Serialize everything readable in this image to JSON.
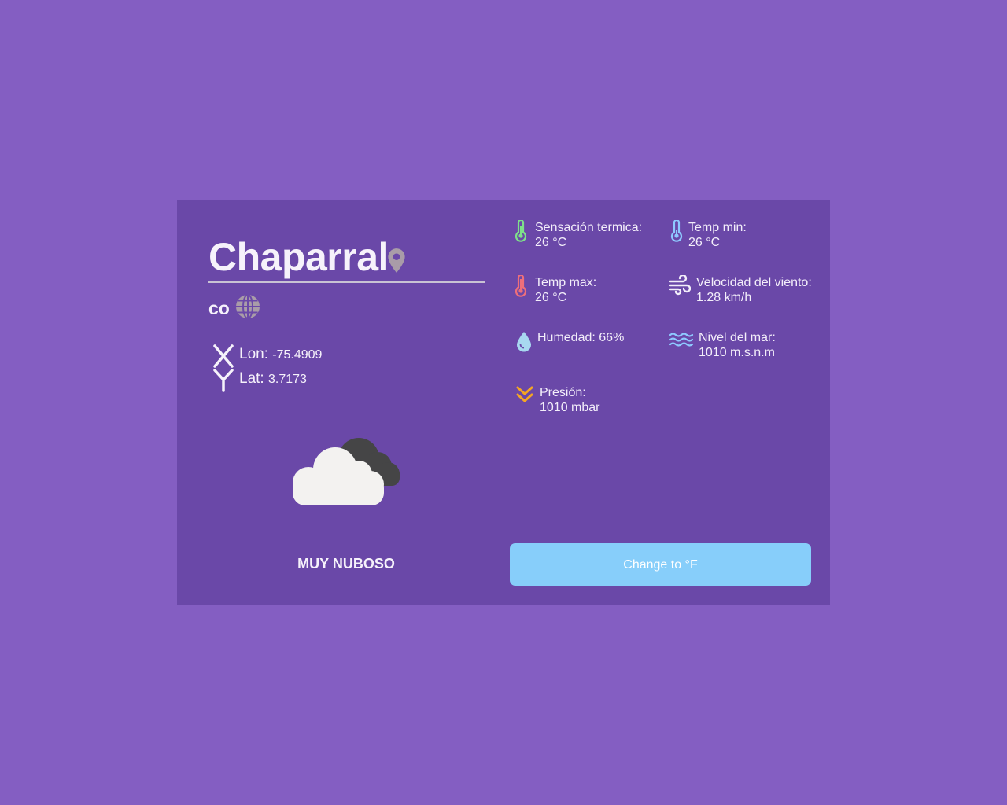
{
  "location": {
    "city": "Chaparral",
    "country": "co",
    "lon_label": "Lon:",
    "lon_value": "-75.4909",
    "lat_label": "Lat:",
    "lat_value": "3.7173"
  },
  "weather": {
    "description": "MUY NUBOSO",
    "icon": "broken-clouds"
  },
  "stats": {
    "feels_like": {
      "label": "Sensación termica:",
      "value": "26 °C",
      "icon": "thermometer-green"
    },
    "temp_min": {
      "label": "Temp min:",
      "value": "26 °C",
      "icon": "thermometer-blue"
    },
    "temp_max": {
      "label": "Temp max:",
      "value": "26 °C",
      "icon": "thermometer-red"
    },
    "wind": {
      "label": "Velocidad del viento:",
      "value": "1.28 km/h",
      "icon": "wind"
    },
    "humidity": {
      "label": "Humedad: 66%",
      "icon": "droplet"
    },
    "sea_level": {
      "label": "Nivel del mar:",
      "value": "1010 m.s.n.m",
      "icon": "waves"
    },
    "pressure": {
      "label": "Presión:",
      "value": "1010 mbar",
      "icon": "double-chevron-down"
    }
  },
  "actions": {
    "toggle_unit_label": "Change to °F"
  },
  "colors": {
    "background": "#845ec2",
    "card": "#6a48a8",
    "button": "#87cefa",
    "green": "#7ee08a",
    "blue": "#8ec9ff",
    "red": "#ef6f7a",
    "orange": "#f5a623"
  }
}
